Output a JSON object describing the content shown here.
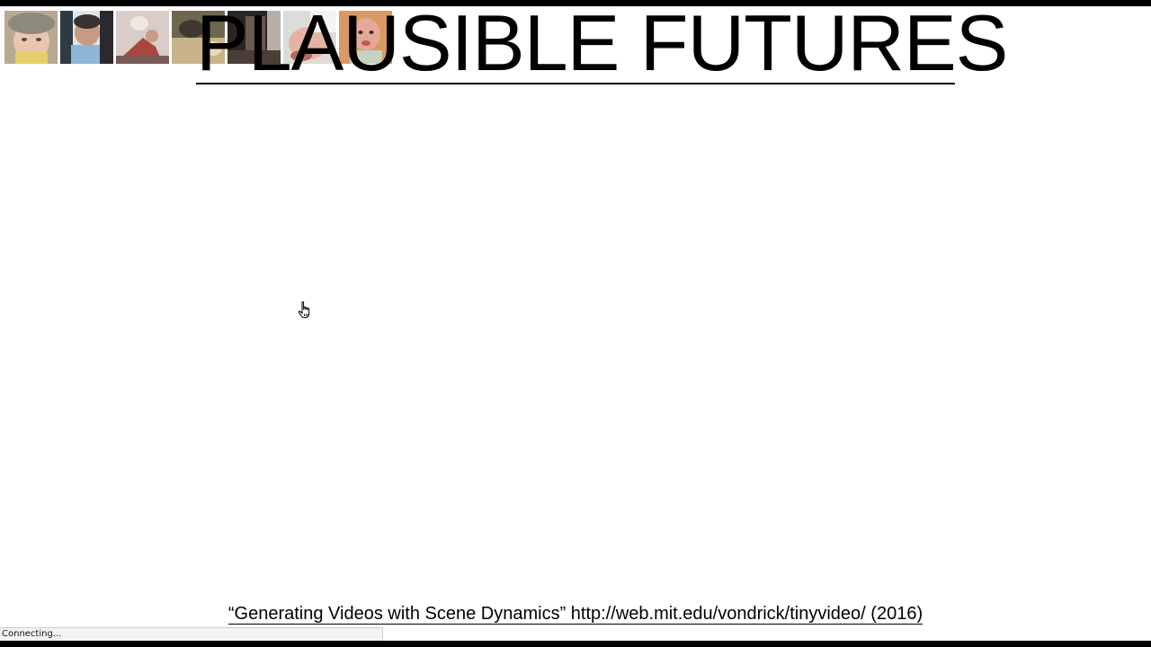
{
  "page": {
    "title": "PLAUSIBLE FUTURES"
  },
  "thumbnails": {
    "count": 7,
    "items": [
      {
        "name": "baby-face-thumbnail"
      },
      {
        "name": "toddler-thumbnail"
      },
      {
        "name": "sleeping-child-thumbnail"
      },
      {
        "name": "blurry-scene-thumbnail"
      },
      {
        "name": "dark-scene-thumbnail"
      },
      {
        "name": "bright-scene-thumbnail"
      },
      {
        "name": "infant-thumbnail"
      }
    ]
  },
  "caption": {
    "text": "“Generating Videos with Scene Dynamics” http://web.mit.edu/vondrick/tinyvideo/ (2016)"
  },
  "status_bar": {
    "text": "Connecting..."
  },
  "colors": {
    "background": "#ffffff",
    "text": "#000000",
    "frame_bars": "#000000",
    "status_background": "#f3f3f3"
  },
  "cursor": {
    "icon": "hand-pointer-icon"
  }
}
